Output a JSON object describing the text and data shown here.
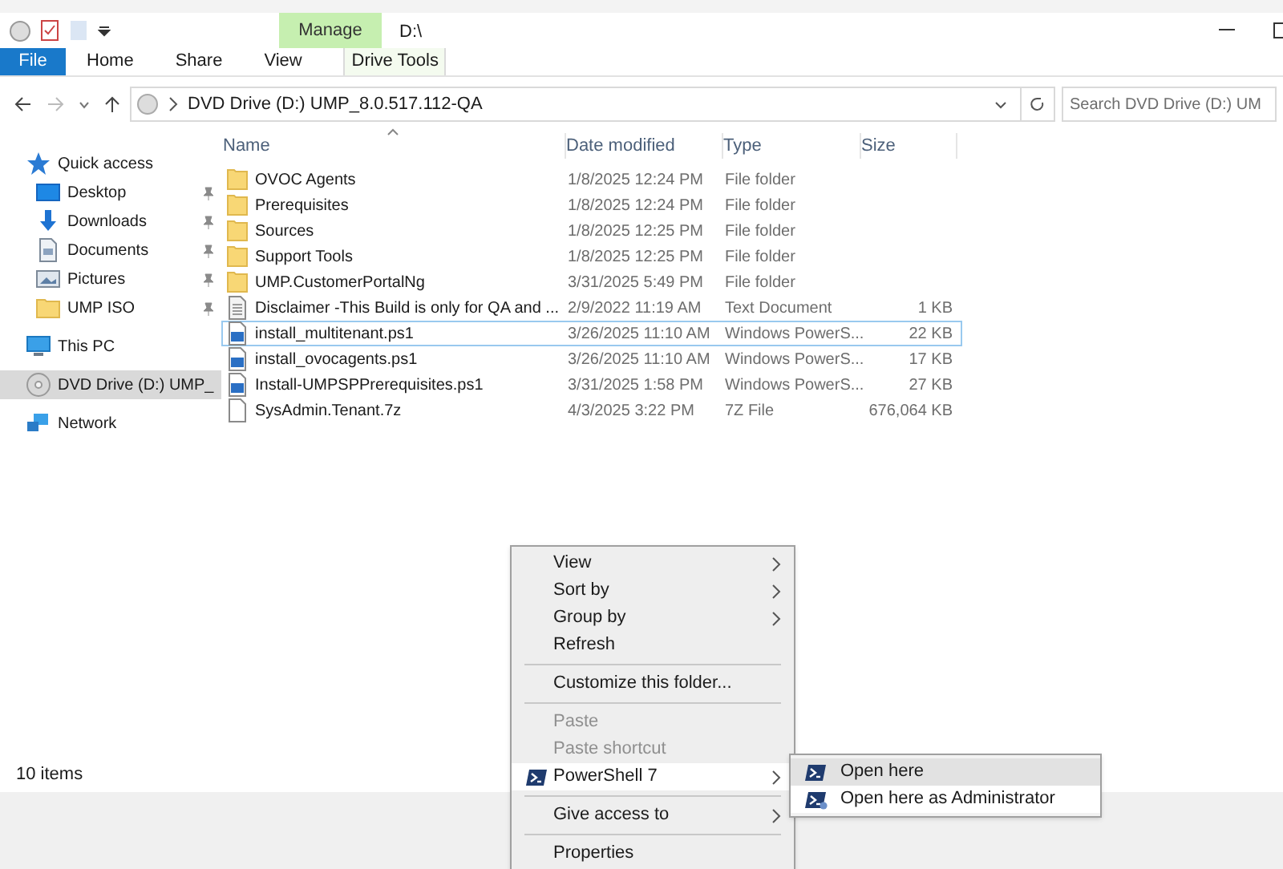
{
  "title_bar": {
    "contextual_group": "Manage",
    "path": "D:\\"
  },
  "ribbon_tabs": [
    {
      "label": "File",
      "kind": "file",
      "selected": false
    },
    {
      "label": "Home",
      "kind": "tab",
      "selected": false
    },
    {
      "label": "Share",
      "kind": "tab",
      "selected": false
    },
    {
      "label": "View",
      "kind": "tab",
      "selected": false
    },
    {
      "label": "Drive Tools",
      "kind": "contextual",
      "selected": false
    }
  ],
  "address_bar": {
    "path": "DVD Drive (D:) UMP_8.0.517.112-QA"
  },
  "search": {
    "placeholder": "Search DVD Drive (D:) UM"
  },
  "sidebar": {
    "items": [
      {
        "label": "Quick access",
        "kind": "star",
        "selected": false,
        "children": [
          {
            "label": "Desktop",
            "kind": "desktop",
            "pinned": true,
            "selected": false
          },
          {
            "label": "Downloads",
            "kind": "download",
            "pinned": true,
            "selected": false
          },
          {
            "label": "Documents",
            "kind": "document",
            "pinned": true,
            "selected": false
          },
          {
            "label": "Pictures",
            "kind": "picture",
            "pinned": true,
            "selected": false
          },
          {
            "label": "UMP ISO",
            "kind": "folder",
            "pinned": true,
            "selected": false
          }
        ]
      },
      {
        "label": "This PC",
        "kind": "pc",
        "selected": false
      },
      {
        "label": "DVD Drive (D:) UMP_",
        "kind": "disc",
        "selected": true
      },
      {
        "label": "Network",
        "kind": "network",
        "selected": false
      }
    ]
  },
  "table": {
    "columns": [
      "Name",
      "Date modified",
      "Type",
      "Size"
    ],
    "rows": [
      {
        "kind": "folder",
        "name": "OVOC Agents",
        "date": "1/8/2025 12:24 PM",
        "type": "File folder",
        "size": "",
        "focused": false
      },
      {
        "kind": "folder",
        "name": "Prerequisites",
        "date": "1/8/2025 12:24 PM",
        "type": "File folder",
        "size": "",
        "focused": false
      },
      {
        "kind": "folder",
        "name": "Sources",
        "date": "1/8/2025 12:25 PM",
        "type": "File folder",
        "size": "",
        "focused": false
      },
      {
        "kind": "folder",
        "name": "Support Tools",
        "date": "1/8/2025 12:25 PM",
        "type": "File folder",
        "size": "",
        "focused": false
      },
      {
        "kind": "folder",
        "name": "UMP.CustomerPortalNg",
        "date": "3/31/2025 5:49 PM",
        "type": "File folder",
        "size": "",
        "focused": false
      },
      {
        "kind": "text",
        "name": "Disclaimer -This Build is only for QA and ...",
        "date": "2/9/2022 11:19 AM",
        "type": "Text Document",
        "size": "1 KB",
        "focused": false
      },
      {
        "kind": "script",
        "name": "install_multitenant.ps1",
        "date": "3/26/2025 11:10 AM",
        "type": "Windows PowerS...",
        "size": "22 KB",
        "focused": true
      },
      {
        "kind": "script",
        "name": "install_ovocagents.ps1",
        "date": "3/26/2025 11:10 AM",
        "type": "Windows PowerS...",
        "size": "17 KB",
        "focused": false
      },
      {
        "kind": "script",
        "name": "Install-UMPSPPrerequisites.ps1",
        "date": "3/31/2025 1:58 PM",
        "type": "Windows PowerS...",
        "size": "27 KB",
        "focused": false
      },
      {
        "kind": "archive",
        "name": "SysAdmin.Tenant.7z",
        "date": "4/3/2025 3:22 PM",
        "type": "7Z File",
        "size": "676,064 KB",
        "focused": false
      }
    ]
  },
  "status_bar": {
    "item_count": "10 items"
  },
  "context_menu": {
    "items": [
      {
        "kind": "item",
        "label": "View",
        "submenu": true,
        "disabled": false,
        "selected": false,
        "icon": false
      },
      {
        "kind": "item",
        "label": "Sort by",
        "submenu": true,
        "disabled": false,
        "selected": false,
        "icon": false
      },
      {
        "kind": "item",
        "label": "Group by",
        "submenu": true,
        "disabled": false,
        "selected": false,
        "icon": false
      },
      {
        "kind": "item",
        "label": "Refresh",
        "submenu": false,
        "disabled": false,
        "selected": false,
        "icon": false
      },
      {
        "kind": "separator"
      },
      {
        "kind": "item",
        "label": "Customize this folder...",
        "submenu": false,
        "disabled": false,
        "selected": false,
        "icon": false
      },
      {
        "kind": "separator"
      },
      {
        "kind": "item",
        "label": "Paste",
        "submenu": false,
        "disabled": true,
        "selected": false,
        "icon": false
      },
      {
        "kind": "item",
        "label": "Paste shortcut",
        "submenu": false,
        "disabled": true,
        "selected": false,
        "icon": false
      },
      {
        "kind": "item",
        "label": "PowerShell 7",
        "submenu": true,
        "disabled": false,
        "selected": true,
        "icon": true
      },
      {
        "kind": "separator"
      },
      {
        "kind": "item",
        "label": "Give access to",
        "submenu": true,
        "disabled": false,
        "selected": false,
        "icon": false
      },
      {
        "kind": "separator"
      },
      {
        "kind": "item",
        "label": "Properties",
        "submenu": false,
        "disabled": false,
        "selected": false,
        "icon": false
      }
    ]
  },
  "submenu": {
    "items": [
      {
        "label": "Open here",
        "selected": true,
        "admin": false
      },
      {
        "label": "Open here as Administrator",
        "selected": false,
        "admin": true
      }
    ]
  }
}
